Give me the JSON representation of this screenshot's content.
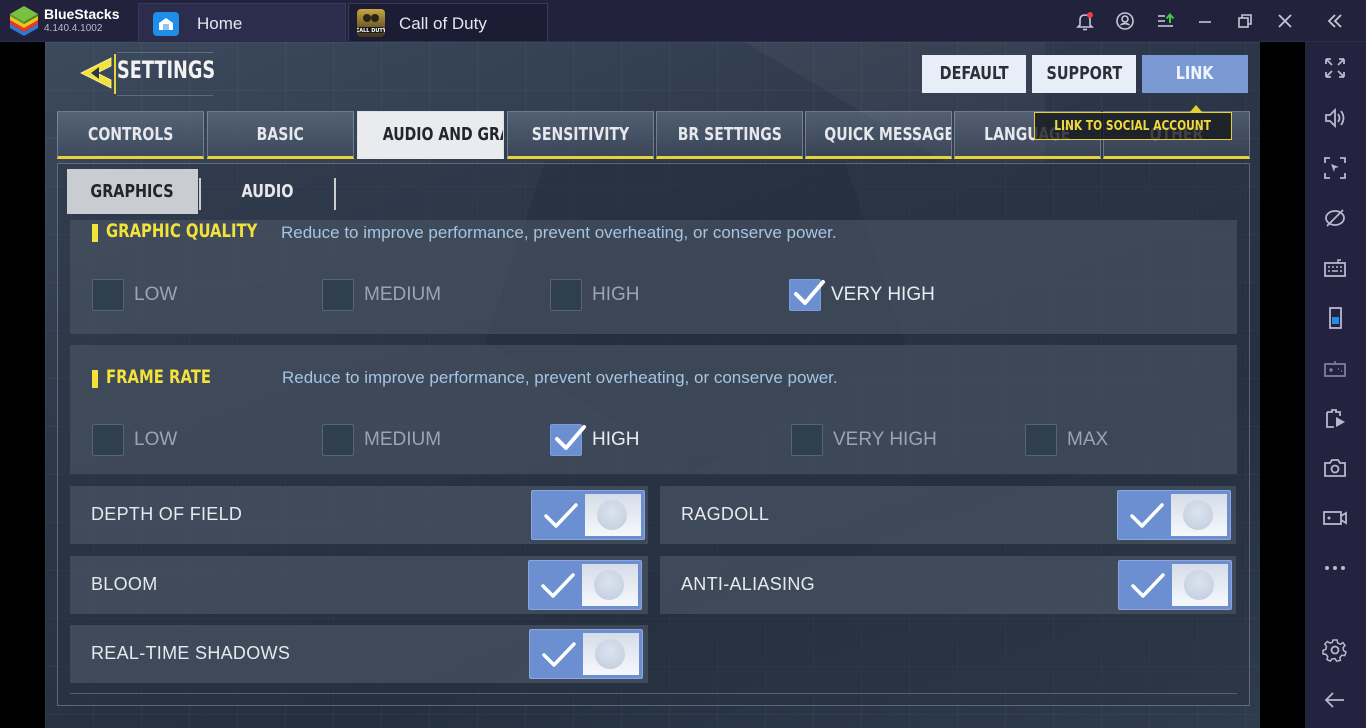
{
  "titlebar": {
    "app_name": "BlueStacks",
    "version": "4.140.4.1002",
    "tabs": [
      {
        "label": "Home",
        "icon": "home-icon"
      },
      {
        "label": "Call of Duty",
        "icon": "call-of-duty-app-icon"
      }
    ],
    "controls": [
      "notification-bell-icon",
      "account-icon",
      "install-apk-icon",
      "minimize-icon",
      "restore-icon",
      "close-icon",
      "collapse-sidebar-icon"
    ]
  },
  "sidebar": {
    "items": [
      "fullscreen-icon",
      "volume-icon",
      "screen-pointer-icon",
      "hide-cursor-icon",
      "keyboard-controls-icon",
      "portrait-mode-icon",
      "gamepad-icon",
      "media-manager-icon",
      "screenshot-icon",
      "record-video-icon",
      "more-icon",
      "settings-gear-icon",
      "back-arrow-icon"
    ]
  },
  "game": {
    "title": "SETTINGS",
    "buttons": {
      "default": "DEFAULT",
      "support": "SUPPORT",
      "link": "LINK"
    },
    "tooltip": "LINK TO SOCIAL ACCOUNT",
    "tabs": [
      "CONTROLS",
      "BASIC",
      "AUDIO AND GRAPHICS",
      "SENSITIVITY",
      "BR SETTINGS",
      "QUICK MESSAGE",
      "LANGUAGE",
      "OTHER"
    ],
    "active_tab": "AUDIO AND GRAPHICS",
    "subtabs": [
      "GRAPHICS",
      "AUDIO"
    ],
    "active_subtab": "GRAPHICS",
    "graphic_quality": {
      "title": "GRAPHIC QUALITY",
      "description": "Reduce to improve performance, prevent overheating, or conserve power.",
      "options": [
        {
          "label": "LOW",
          "checked": false
        },
        {
          "label": "MEDIUM",
          "checked": false
        },
        {
          "label": "HIGH",
          "checked": false
        },
        {
          "label": "VERY HIGH",
          "checked": true
        }
      ]
    },
    "frame_rate": {
      "title": "FRAME RATE",
      "description": "Reduce to improve performance, prevent overheating, or conserve power.",
      "options": [
        {
          "label": "LOW",
          "checked": false
        },
        {
          "label": "MEDIUM",
          "checked": false
        },
        {
          "label": "HIGH",
          "checked": true
        },
        {
          "label": "VERY HIGH",
          "checked": false
        },
        {
          "label": "MAX",
          "checked": false
        }
      ]
    },
    "toggles": [
      {
        "label": "DEPTH OF FIELD",
        "on": true
      },
      {
        "label": "RAGDOLL",
        "on": true
      },
      {
        "label": "BLOOM",
        "on": true
      },
      {
        "label": "ANTI-ALIASING",
        "on": true
      },
      {
        "label": "REAL-TIME SHADOWS",
        "on": true
      }
    ]
  },
  "colors": {
    "accent_yellow": "#f2e23a",
    "checked_blue": "#6b8fd0",
    "link_button": "#7b9ad4",
    "titlebar": "#22223d",
    "sidebar": "#23233f"
  }
}
